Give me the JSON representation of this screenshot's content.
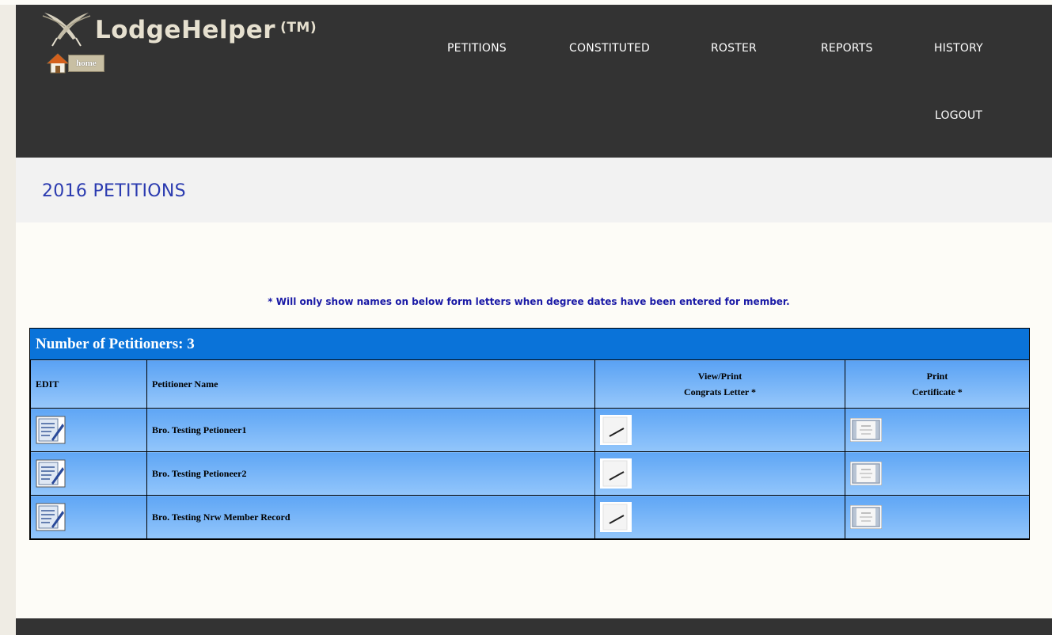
{
  "app": {
    "logo_text": "LodgeHelper",
    "logo_tm": "(TM)",
    "home_label": "home"
  },
  "nav": {
    "petitions": "PETITIONS",
    "constituted": "CONSTITUTED",
    "roster": "ROSTER",
    "reports": "REPORTS",
    "history": "HISTORY",
    "logout": "LOGOUT"
  },
  "page": {
    "title": "2016 PETITIONS",
    "notice": "* Will only show names on below form letters when degree dates have been entered for member."
  },
  "grid": {
    "title": "Number of Petitioners:  3",
    "headers": {
      "edit": "EDIT",
      "name": "Petitioner Name",
      "letter_line1": "View/Print",
      "letter_line2": "Congrats Letter *",
      "cert_line1": "Print",
      "cert_line2": "Certificate *"
    },
    "rows": [
      {
        "name": "Bro. Testing Petioneer1"
      },
      {
        "name": "Bro. Testing Petioneer2"
      },
      {
        "name": "Bro. Testing Nrw Member Record"
      }
    ]
  },
  "colors": {
    "header_bg": "#333333",
    "title_color": "#2b3bb0",
    "grid_title_bg": "#0a73d9",
    "grid_body": "#7ab6f8"
  },
  "icons": [
    "feather-logo-icon",
    "home-icon",
    "edit-record-icon",
    "pen-letter-icon",
    "certificate-icon"
  ]
}
